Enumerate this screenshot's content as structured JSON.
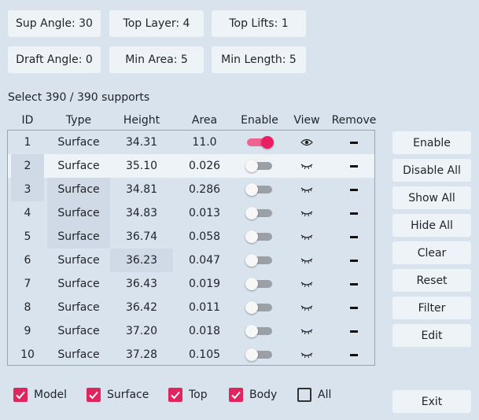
{
  "params": [
    {
      "label": "Sup Angle: 30"
    },
    {
      "label": "Top Layer: 4"
    },
    {
      "label": "Top Lifts: 1"
    },
    {
      "label": "Draft Angle: 0"
    },
    {
      "label": "Min Area: 5"
    },
    {
      "label": "Min Length: 5"
    }
  ],
  "selection_label": "Select 390 / 390 supports",
  "table": {
    "headers": [
      "ID",
      "Type",
      "Height",
      "Area",
      "Enable",
      "View",
      "Remove"
    ],
    "rows": [
      {
        "id": "1",
        "type": "Surface",
        "height": "34.31",
        "area": "11.0",
        "enabled": true,
        "view": "eye-open"
      },
      {
        "id": "2",
        "type": "Surface",
        "height": "35.10",
        "area": "0.026",
        "enabled": false,
        "view": "eye-closed"
      },
      {
        "id": "3",
        "type": "Surface",
        "height": "34.81",
        "area": "0.286",
        "enabled": false,
        "view": "eye-closed"
      },
      {
        "id": "4",
        "type": "Surface",
        "height": "34.83",
        "area": "0.013",
        "enabled": false,
        "view": "eye-closed"
      },
      {
        "id": "5",
        "type": "Surface",
        "height": "36.74",
        "area": "0.058",
        "enabled": false,
        "view": "eye-closed"
      },
      {
        "id": "6",
        "type": "Surface",
        "height": "36.23",
        "area": "0.047",
        "enabled": false,
        "view": "eye-closed"
      },
      {
        "id": "7",
        "type": "Surface",
        "height": "36.43",
        "area": "0.019",
        "enabled": false,
        "view": "eye-closed"
      },
      {
        "id": "8",
        "type": "Surface",
        "height": "36.42",
        "area": "0.011",
        "enabled": false,
        "view": "eye-closed"
      },
      {
        "id": "9",
        "type": "Surface",
        "height": "37.20",
        "area": "0.018",
        "enabled": false,
        "view": "eye-closed"
      },
      {
        "id": "10",
        "type": "Surface",
        "height": "37.28",
        "area": "0.105",
        "enabled": false,
        "view": "eye-closed"
      }
    ]
  },
  "actions": [
    {
      "label": "Enable"
    },
    {
      "label": "Disable All"
    },
    {
      "label": "Show All"
    },
    {
      "label": "Hide All"
    },
    {
      "label": "Clear"
    },
    {
      "label": "Reset"
    },
    {
      "label": "Filter"
    },
    {
      "label": "Edit"
    }
  ],
  "filters": [
    {
      "label": "Model",
      "checked": true
    },
    {
      "label": "Surface",
      "checked": true
    },
    {
      "label": "Top",
      "checked": true
    },
    {
      "label": "Body",
      "checked": true
    },
    {
      "label": "All",
      "checked": false
    }
  ],
  "exit_label": "Exit",
  "colors": {
    "accent": "#e0245e",
    "background": "#d8e3ee",
    "button": "#eef3f8"
  }
}
